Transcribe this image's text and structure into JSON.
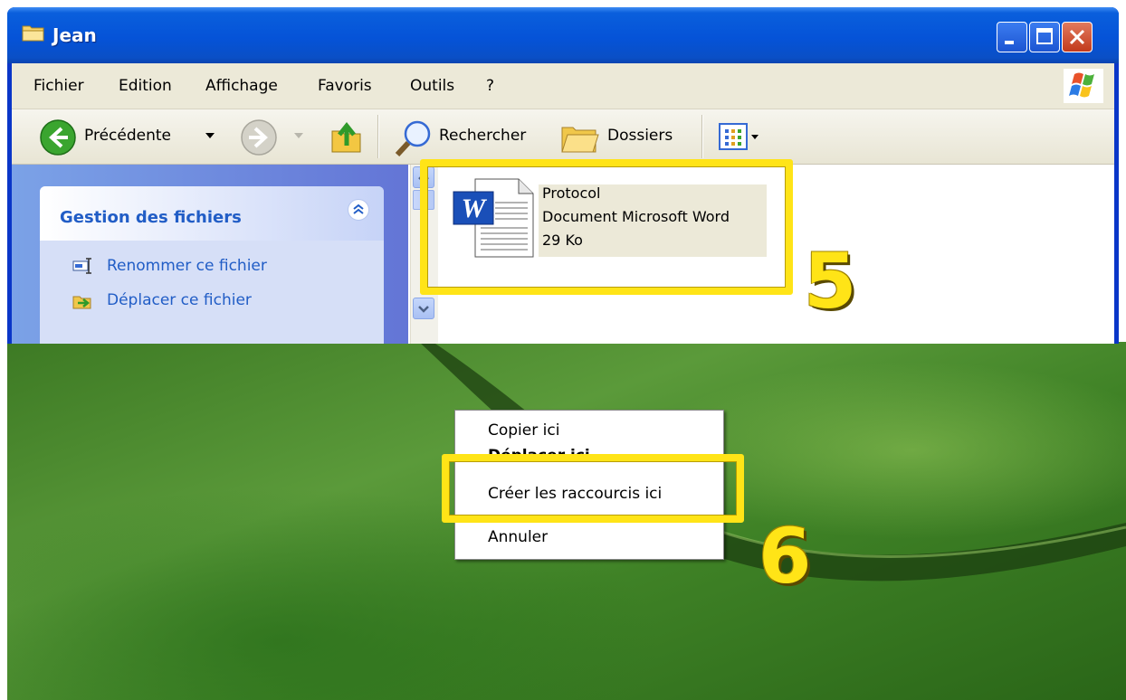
{
  "window": {
    "title": "Jean",
    "controls": [
      "minimize",
      "maximize",
      "close"
    ]
  },
  "menubar": {
    "items": [
      "Fichier",
      "Edition",
      "Affichage",
      "Favoris",
      "Outils",
      "?"
    ]
  },
  "toolbar": {
    "back_label": "Précédente",
    "search_label": "Rechercher",
    "folders_label": "Dossiers"
  },
  "task_panel": {
    "title": "Gestion des fichiers",
    "links": [
      "Renommer ce fichier",
      "Déplacer ce fichier"
    ]
  },
  "file": {
    "name": "Protocol",
    "type": "Document Microsoft Word",
    "size": "29 Ko"
  },
  "context_menu": {
    "items": [
      "Copier ici",
      "Déplacer ici",
      "Créer les raccourcis ici",
      "Annuler"
    ],
    "highlighted": "Créer les raccourcis ici"
  },
  "annotations": {
    "step_5": "5",
    "step_6": "6",
    "color": "#ffe417"
  },
  "colors": {
    "titlebar": "#0553d8",
    "link": "#215dc6",
    "desktop": "#3f8226"
  }
}
